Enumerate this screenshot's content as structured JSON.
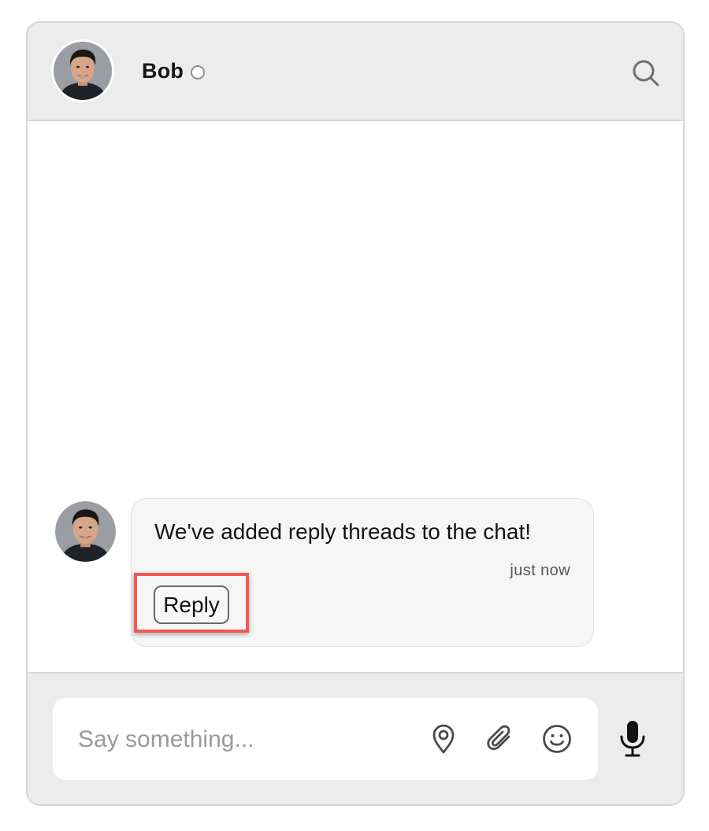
{
  "header": {
    "contact_name": "Bob",
    "presence_status": "offline",
    "search_icon": "search-icon"
  },
  "messages": [
    {
      "sender": "Bob",
      "text": "We've added reply threads to the chat!",
      "time": "just now",
      "reply_label": "Reply"
    }
  ],
  "composer": {
    "placeholder": "Say something...",
    "icons": [
      "location-pin-icon",
      "paperclip-icon",
      "emoji-icon",
      "microphone-icon"
    ]
  },
  "colors": {
    "header_bg": "#ececec",
    "bubble_bg": "#f6f6f6",
    "highlight": "#ef5a50"
  }
}
